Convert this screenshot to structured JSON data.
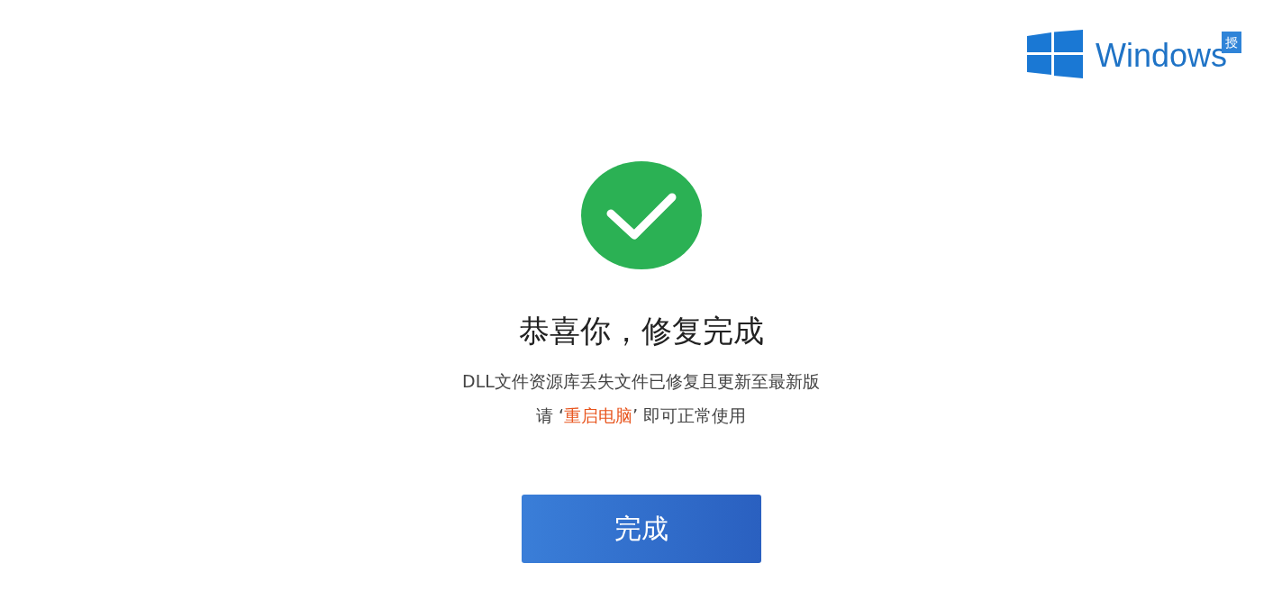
{
  "logo": {
    "text": "Windows",
    "badge": "授"
  },
  "result": {
    "kind": "success",
    "title": "恭喜你，修复完成",
    "lines": [
      [
        {
          "text": "DLL文件资源库丢失文件已修复且更新至最新版",
          "highlight": false
        }
      ],
      [
        {
          "text": "请 ‘",
          "highlight": false
        },
        {
          "text": "重启电脑",
          "highlight": true
        },
        {
          "text": "’ 即可正常使用",
          "highlight": false
        }
      ]
    ]
  },
  "button": {
    "label": "完成"
  }
}
